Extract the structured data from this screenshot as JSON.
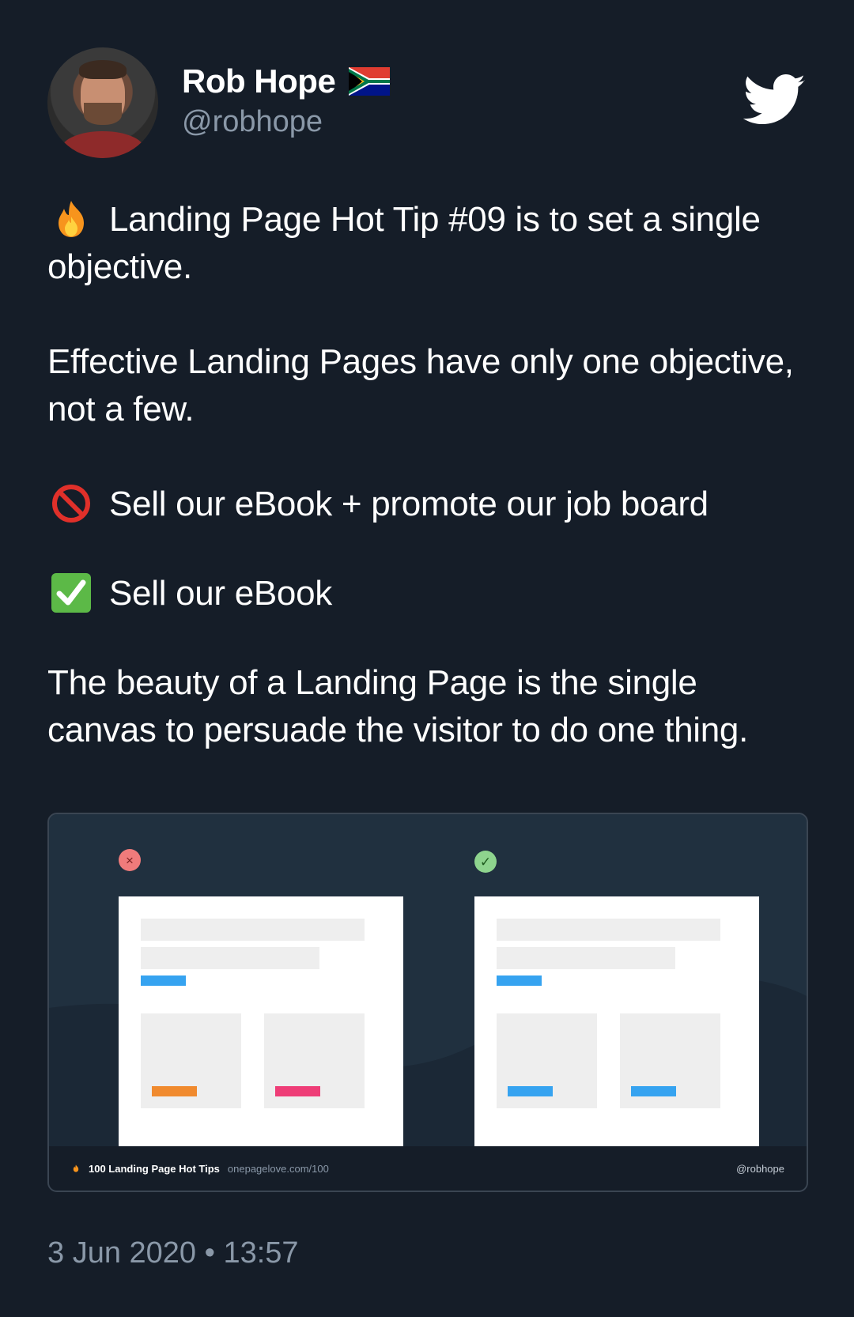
{
  "author": {
    "name": "Rob Hope",
    "handle": "@robhope"
  },
  "tweet": {
    "line1": "Landing Page Hot Tip #09 is to set a single objective.",
    "line2": "Effective Landing Pages have only one objective, not a few.",
    "bad_item": "Sell our eBook + promote our job board",
    "good_item": "Sell our eBook",
    "line3": "The beauty of a Landing Page is the single canvas to persuade the visitor to do one thing."
  },
  "media_card": {
    "bad_mark": "×",
    "good_mark": "✓",
    "footer_title": "100 Landing Page Hot Tips",
    "footer_url": "onepagelove.com/100",
    "footer_handle": "@robhope"
  },
  "timestamp": "3 Jun 2020 • 13:57",
  "colors": {
    "background": "#151d28",
    "card_background": "#20303f",
    "accent_blue": "#36a3f0",
    "accent_orange": "#f08a2e",
    "accent_pink": "#ee3d77",
    "muted_text": "#8a98a8"
  },
  "icons": [
    "fire-icon",
    "no-entry-icon",
    "check-mark-icon",
    "twitter-bird-icon",
    "south-africa-flag-icon"
  ]
}
